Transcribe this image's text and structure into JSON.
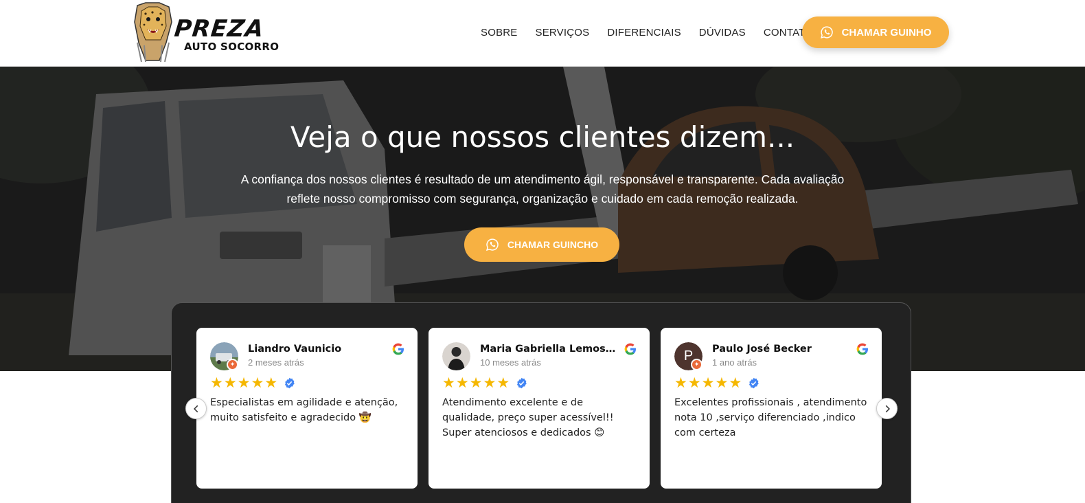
{
  "brand": {
    "name": "PREZA",
    "tagline": "AUTO SOCORRO"
  },
  "nav": {
    "items": [
      "SOBRE",
      "SERVIÇOS",
      "DIFERENCIAIS",
      "DÚVIDAS",
      "CONTATO"
    ],
    "cta_label": "CHAMAR GUINHO"
  },
  "hero": {
    "title": "Veja o que nossos clientes dizem...",
    "description": "A confiança dos nossos clientes é resultado de um atendimento ágil, responsável e transparente. Cada avaliação reflete nosso compromisso com segurança, organização e cuidado em cada remoção realizada.",
    "cta_label": "CHAMAR GUINCHO"
  },
  "reviews": [
    {
      "name": "Liandro Vaunicio",
      "date": "2 meses atrás",
      "rating": 5,
      "text": "Especialistas em agilidade e atenção, muito satisfeito e agradecido 🤠",
      "avatar_icon": "photo-avatar"
    },
    {
      "name": "Maria Gabriella Lemos d...",
      "date": "10 meses atrás",
      "rating": 5,
      "text": "Atendimento excelente e de qualidade, preço super acessível!! Super atenciosos e dedicados 😊",
      "avatar_icon": "photo-avatar"
    },
    {
      "name": "Paulo José Becker",
      "date": "1 ano atrás",
      "rating": 5,
      "text": "Excelentes profissionais , atendimento nota 10 ,serviço diferenciado ,indico com certeza",
      "avatar_initial": "P"
    }
  ],
  "colors": {
    "accent": "#f7b142",
    "panel": "#222222",
    "star": "#f5b700",
    "verified": "#4285f4"
  },
  "icons": {
    "whatsapp": "whatsapp-icon",
    "google": "google-icon",
    "verified": "verified-check-icon",
    "prev": "chevron-left-icon",
    "next": "chevron-right-icon"
  }
}
